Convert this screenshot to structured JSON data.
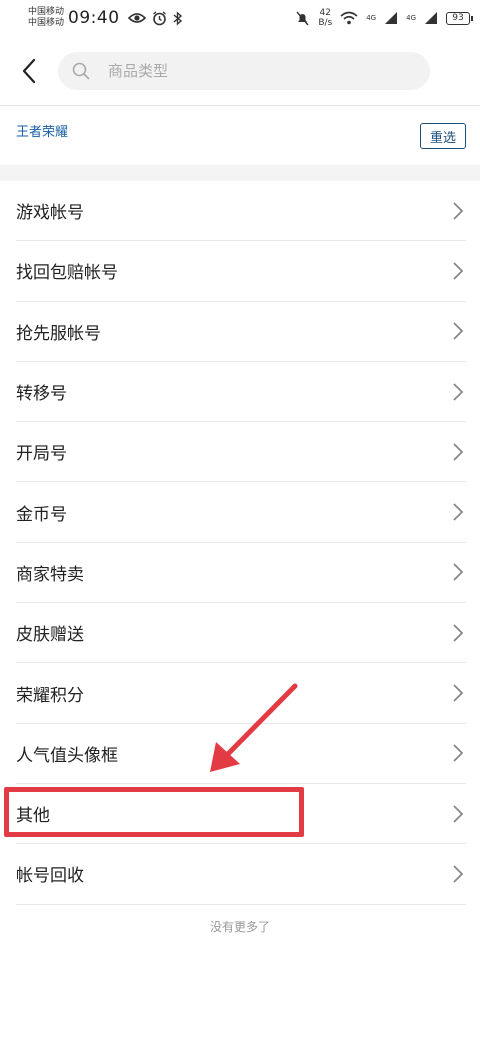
{
  "status_bar": {
    "carrier_1": "中国移动",
    "carrier_2": "中国移动",
    "time": "09:40",
    "net_speed_value": "42",
    "net_speed_unit": "B/s",
    "signal_1": "4G",
    "signal_2": "4G",
    "battery": "93"
  },
  "header": {
    "search_placeholder": "商品类型"
  },
  "filter": {
    "selected_tag": "王者荣耀",
    "reset_label": "重选"
  },
  "list": {
    "items": [
      {
        "label": "游戏帐号"
      },
      {
        "label": "找回包赔帐号"
      },
      {
        "label": "抢先服帐号"
      },
      {
        "label": "转移号"
      },
      {
        "label": "开局号"
      },
      {
        "label": "金币号"
      },
      {
        "label": "商家特卖"
      },
      {
        "label": "皮肤赠送"
      },
      {
        "label": "荣耀积分"
      },
      {
        "label": "人气值头像框"
      },
      {
        "label": "其他"
      },
      {
        "label": "帐号回收"
      }
    ]
  },
  "footer": {
    "no_more": "没有更多了"
  },
  "colors": {
    "accent_blue": "#1a5fa8",
    "annotation_red": "#e23b44"
  }
}
